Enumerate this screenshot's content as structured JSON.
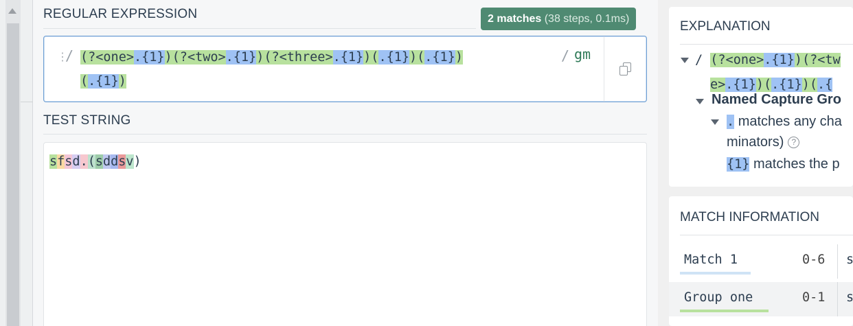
{
  "regex_panel": {
    "title": "REGULAR EXPRESSION",
    "match_badge": {
      "count": "2 matches",
      "detail": "(38 steps, 0.1ms)"
    },
    "open_delimiter": "/",
    "close_delimiter": "/",
    "flags": "gm",
    "line1": [
      {
        "text": "(?<one>",
        "hl": "g"
      },
      {
        "text": ".{1}",
        "hl": "b2c"
      },
      {
        "text": ")(?<two>",
        "hl": "g"
      },
      {
        "text": ".{1}",
        "hl": "b2c"
      },
      {
        "text": ")(?<three>",
        "hl": "g"
      },
      {
        "text": ".{1}",
        "hl": "b2c"
      },
      {
        "text": ")(",
        "hl": "g"
      },
      {
        "text": ".{1}",
        "hl": "b2c"
      },
      {
        "text": ")(",
        "hl": "g"
      },
      {
        "text": ".{1}",
        "hl": "b2c"
      },
      {
        "text": ")",
        "hl": "g"
      }
    ],
    "line2": [
      {
        "text": "(",
        "hl": "g"
      },
      {
        "text": ".{1}",
        "hl": "b2c"
      },
      {
        "text": ")",
        "hl": "g"
      }
    ]
  },
  "test_panel": {
    "title": "TEST STRING",
    "chars": [
      "s",
      "f",
      "s",
      "d",
      ".",
      "(",
      "s",
      "d",
      "d",
      "s",
      "v",
      ")"
    ]
  },
  "explanation": {
    "title": "EXPLANATION",
    "regex_line1_prefix": "/ ",
    "regex_line1": [
      {
        "text": "(?<one>",
        "hl": "g"
      },
      {
        "text": ".{1}",
        "hl": "b2c"
      },
      {
        "text": ")(?<tw",
        "hl": "g"
      }
    ],
    "regex_line2": [
      {
        "text": "e>",
        "hl": "g"
      },
      {
        "text": ".{1}",
        "hl": "b2c"
      },
      {
        "text": ")(",
        "hl": "g"
      },
      {
        "text": ".{1}",
        "hl": "b2c"
      },
      {
        "text": ")(",
        "hl": "g"
      },
      {
        "text": ".{",
        "hl": "b2c"
      }
    ],
    "node_title": "Named Capture Gro",
    "dot_token": ".",
    "dot_desc": "matches any cha",
    "dot_desc_cont": "minators)",
    "help_glyph": "?",
    "quant_token": "{1}",
    "quant_desc": "matches the p"
  },
  "match_info": {
    "title": "MATCH INFORMATION",
    "rows": [
      {
        "label": "Match 1",
        "range": "0-6",
        "value": "s"
      },
      {
        "label": "Group one",
        "range": "0-1",
        "value": "s"
      }
    ]
  }
}
